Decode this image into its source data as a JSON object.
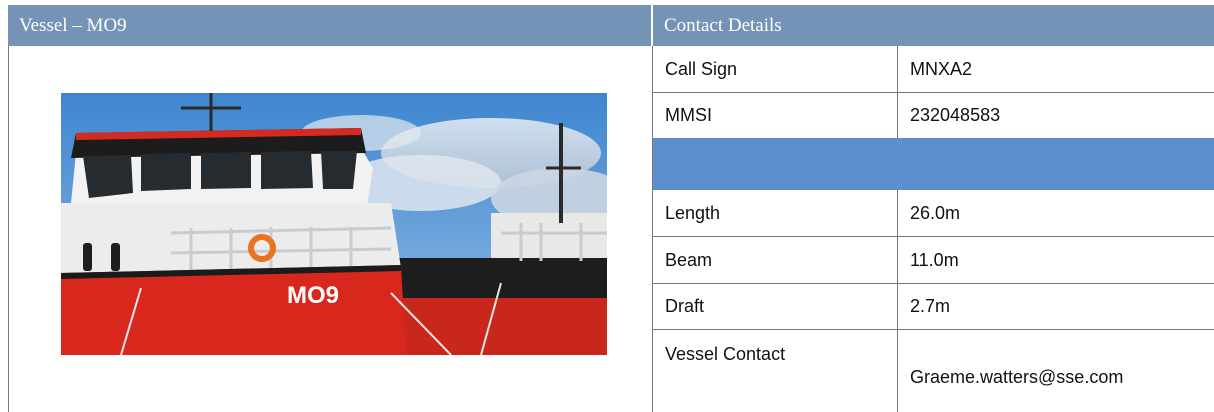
{
  "vessel_panel": {
    "title": "Vessel – MO9",
    "photo_caption": "MO9"
  },
  "contact_panel": {
    "title": "Contact Details",
    "rows": [
      {
        "label": "Call Sign",
        "value": "MNXA2"
      },
      {
        "label": "MMSI",
        "value": "232048583"
      },
      {
        "label": "",
        "value": ""
      },
      {
        "label": "Length",
        "value": "26.0m"
      },
      {
        "label": "Beam",
        "value": "11.0m"
      },
      {
        "label": "Draft",
        "value": "2.7m"
      },
      {
        "label": "Vessel Contact",
        "value": "Graeme.watters@sse.com"
      }
    ]
  },
  "colors": {
    "header": "#7593b7",
    "band": "#5b8fd0",
    "hull_red": "#d8281e"
  }
}
